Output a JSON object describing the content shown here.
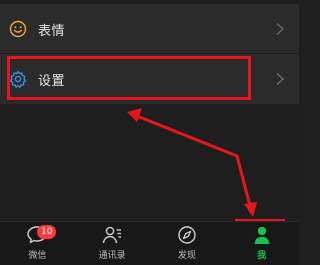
{
  "colors": {
    "accent_green": "#1fbf4c",
    "annotation_red": "#e8141b",
    "badge_red": "#fa3b3b",
    "settings_icon_blue": "#3b8fe0",
    "emoji_icon_orange": "#f2a93b"
  },
  "menu": {
    "items": [
      {
        "label": "表情",
        "icon": "smiley-icon"
      },
      {
        "label": "设置",
        "icon": "gear-icon"
      }
    ]
  },
  "tabbar": {
    "tabs": [
      {
        "label": "微信",
        "icon": "chat-bubble-icon",
        "badge": "10"
      },
      {
        "label": "通讯录",
        "icon": "contacts-icon"
      },
      {
        "label": "发现",
        "icon": "compass-icon"
      },
      {
        "label": "我",
        "icon": "person-icon",
        "active": true
      }
    ]
  }
}
